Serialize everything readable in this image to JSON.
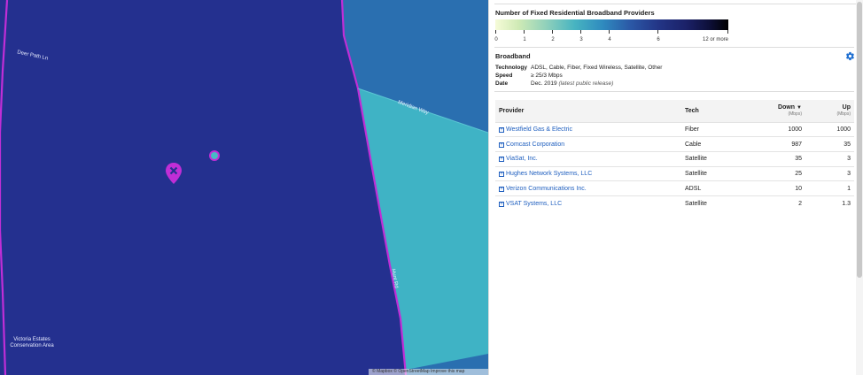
{
  "map": {
    "roads": {
      "deer_path": "Deer Path Ln",
      "meridian": "Meridian Way",
      "hunt_rd": "Hunt Rd"
    },
    "area": {
      "line1": "Victoria Estates",
      "line2": "Conservation Area"
    },
    "attribution": "© Mapbox © OpenStreetMap Improve this map",
    "colors": {
      "zone_dark": "#24308f",
      "zone_mid": "#2a6fb0",
      "zone_light": "#3fb3c5",
      "boundary": "#c02ed6",
      "marker": "#c02ed6"
    },
    "marker_icon": "map-pin-icon",
    "dot_icon": "location-dot-icon"
  },
  "legend": {
    "title": "Number of Fixed Residential Broadband Providers",
    "ticks": [
      "0",
      "1",
      "2",
      "3",
      "4",
      "6",
      "12 or more"
    ]
  },
  "broadband": {
    "title": "Broadband",
    "settings_icon": "gear-icon",
    "technology_label": "Technology",
    "technology_value": "ADSL, Cable, Fiber, Fixed Wireless, Satellite, Other",
    "speed_label": "Speed",
    "speed_value": "≥ 25/3 Mbps",
    "date_label": "Date",
    "date_value": "Dec. 2019",
    "date_note": "(latest public release)"
  },
  "table": {
    "headers": {
      "provider": "Provider",
      "tech": "Tech",
      "down": "Down",
      "down_unit": "(Mbps)",
      "up": "Up",
      "up_unit": "(Mbps)",
      "sort_icon": "sort-down-icon"
    },
    "rows": [
      {
        "provider": "Westfield Gas & Electric",
        "tech": "Fiber",
        "down": "1000",
        "up": "1000"
      },
      {
        "provider": "Comcast Corporation",
        "tech": "Cable",
        "down": "987",
        "up": "35"
      },
      {
        "provider": "ViaSat, Inc.",
        "tech": "Satellite",
        "down": "35",
        "up": "3"
      },
      {
        "provider": "Hughes Network Systems, LLC",
        "tech": "Satellite",
        "down": "25",
        "up": "3"
      },
      {
        "provider": "Verizon Communications Inc.",
        "tech": "ADSL",
        "down": "10",
        "up": "1"
      },
      {
        "provider": "VSAT Systems, LLC",
        "tech": "Satellite",
        "down": "2",
        "up": "1.3"
      }
    ]
  }
}
